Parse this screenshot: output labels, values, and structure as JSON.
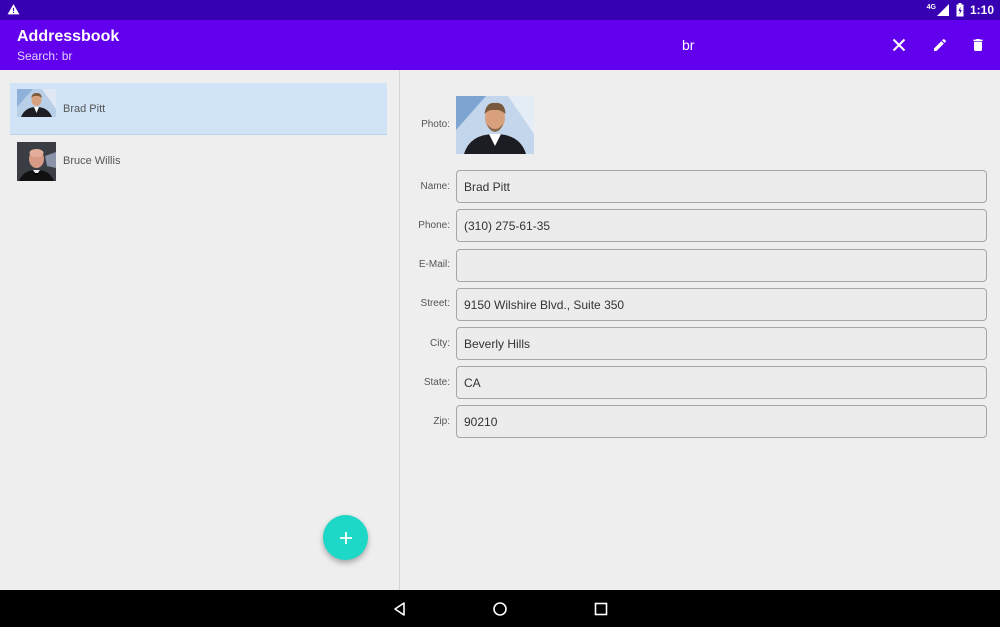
{
  "status_bar": {
    "network": "4G",
    "time": "1:10",
    "icons": [
      "warning-icon",
      "signal-icon",
      "battery-icon"
    ]
  },
  "app_bar": {
    "title": "Addressbook",
    "subtitle": "Search: br",
    "query": "br",
    "actions": [
      "close-icon",
      "edit-icon",
      "delete-icon"
    ]
  },
  "contacts": [
    {
      "name": "Brad Pitt",
      "selected": true
    },
    {
      "name": "Bruce Willis",
      "selected": false
    }
  ],
  "fab": {
    "icon": "plus-icon"
  },
  "detail": {
    "labels": {
      "photo": "Photo:",
      "name": "Name:",
      "phone": "Phone:",
      "email": "E-Mail:",
      "street": "Street:",
      "city": "City:",
      "state": "State:",
      "zip": "Zip:"
    },
    "values": {
      "name": "Brad Pitt",
      "phone": "(310) 275-61-35",
      "email": "",
      "street": "9150 Wilshire Blvd., Suite 350",
      "city": "Beverly Hills",
      "state": "CA",
      "zip": "90210"
    }
  },
  "nav_bar": {
    "icons": [
      "back-icon",
      "home-icon",
      "recents-icon"
    ]
  },
  "colors": {
    "status_bar": "#3700b3",
    "app_bar": "#6200ee",
    "accent": "#1ed8c7",
    "selected_row": "#d1e4f7"
  }
}
